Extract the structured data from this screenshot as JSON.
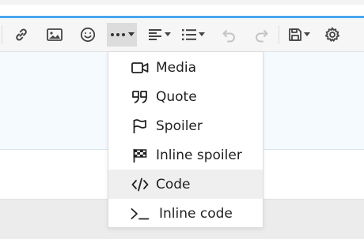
{
  "toolbar": {
    "buttons": [
      {
        "id": "link",
        "icon": "link-icon"
      },
      {
        "id": "image",
        "icon": "image-icon"
      },
      {
        "id": "emoji",
        "icon": "smiley-icon"
      },
      {
        "id": "more",
        "icon": "ellipsis-icon",
        "dropdown": true,
        "active": true
      },
      {
        "id": "align",
        "icon": "align-left-icon",
        "dropdown": true
      },
      {
        "id": "list",
        "icon": "list-icon",
        "dropdown": true
      },
      {
        "id": "undo",
        "icon": "undo-icon",
        "disabled": true
      },
      {
        "id": "redo",
        "icon": "redo-icon",
        "disabled": true
      },
      {
        "id": "drafts",
        "icon": "floppy-disk-icon",
        "dropdown": true
      },
      {
        "id": "settings",
        "icon": "gear-icon"
      }
    ]
  },
  "menu": {
    "items": [
      {
        "label": "Media",
        "icon": "video-camera-icon"
      },
      {
        "label": "Quote",
        "icon": "quote-icon"
      },
      {
        "label": "Spoiler",
        "icon": "flag-icon"
      },
      {
        "label": "Inline spoiler",
        "icon": "checkered-flag-icon"
      },
      {
        "label": "Code",
        "icon": "code-icon",
        "highlighted": true
      },
      {
        "label": "Inline code",
        "icon": "terminal-icon"
      }
    ]
  },
  "colors": {
    "accent": "#47a7eb",
    "editor_bg": "#f5faff",
    "menu_hover": "#efefef"
  }
}
